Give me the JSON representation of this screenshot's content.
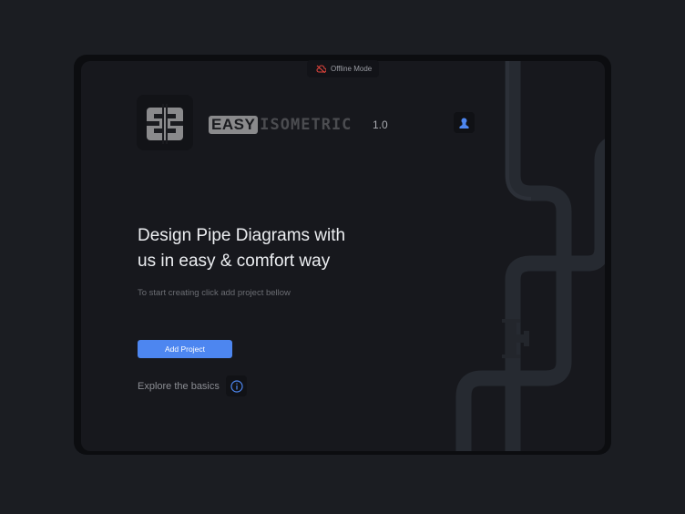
{
  "status": {
    "offline_label": "Offline Mode"
  },
  "brand": {
    "easy": "EASY",
    "isometric": "ISOMETRIC",
    "version": "1.0"
  },
  "hero": {
    "title_line1": "Design Pipe Diagrams with",
    "title_line2": "us in easy & comfort way",
    "subtitle": "To start creating click add project bellow"
  },
  "actions": {
    "add_project": "Add Project",
    "explore": "Explore the basics"
  },
  "colors": {
    "accent": "#4d86f0",
    "offline": "#e0443c",
    "pipe": "#262a31"
  }
}
